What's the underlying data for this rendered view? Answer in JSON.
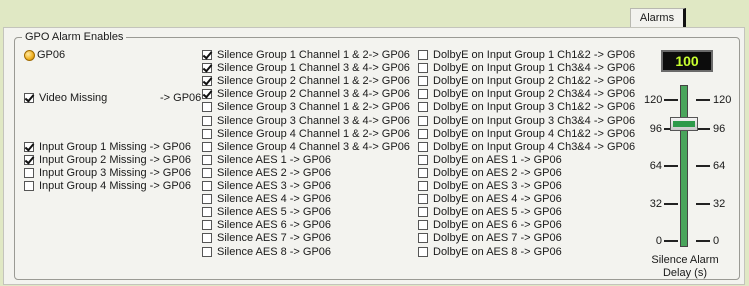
{
  "tabs": {
    "alarms_label": "Alarms"
  },
  "group": {
    "legend": "GPO Alarm Enables"
  },
  "gpo_indicator": {
    "label": "GP06"
  },
  "video_missing": {
    "label": "Video Missing",
    "target": "-> GP06",
    "checked": true
  },
  "input_missing": [
    {
      "label": "Input Group 1 Missing -> GP06",
      "checked": true
    },
    {
      "label": "Input Group 2 Missing -> GP06",
      "checked": true
    },
    {
      "label": "Input Group 3 Missing -> GP06",
      "checked": false
    },
    {
      "label": "Input Group 4 Missing -> GP06",
      "checked": false
    }
  ],
  "silence_groups": [
    {
      "label": "Silence Group 1 Channel 1 & 2-> GP06",
      "checked": true
    },
    {
      "label": "Silence Group 1 Channel 3 & 4-> GP06",
      "checked": true
    },
    {
      "label": "Silence Group 2 Channel 1 & 2-> GP06",
      "checked": true
    },
    {
      "label": "Silence Group 2 Channel 3 & 4-> GP06",
      "checked": true
    },
    {
      "label": "Silence Group 3 Channel 1 & 2-> GP06",
      "checked": false
    },
    {
      "label": "Silence Group 3 Channel 3 & 4-> GP06",
      "checked": false
    },
    {
      "label": "Silence Group 4 Channel 1 & 2-> GP06",
      "checked": false
    },
    {
      "label": "Silence Group 4 Channel 3 & 4-> GP06",
      "checked": false
    }
  ],
  "silence_aes": [
    {
      "label": "Silence AES 1 -> GP06",
      "checked": false
    },
    {
      "label": "Silence AES 2 -> GP06",
      "checked": false
    },
    {
      "label": "Silence AES 3 -> GP06",
      "checked": false
    },
    {
      "label": "Silence AES 4 -> GP06",
      "checked": false
    },
    {
      "label": "Silence AES 5 -> GP06",
      "checked": false
    },
    {
      "label": "Silence AES 6 -> GP06",
      "checked": false
    },
    {
      "label": "Silence AES 7 -> GP06",
      "checked": false
    },
    {
      "label": "Silence AES 8 -> GP06",
      "checked": false
    }
  ],
  "dolbye_groups": [
    {
      "label": "DolbyE on Input Group 1 Ch1&2 -> GP06",
      "checked": false
    },
    {
      "label": "DolbyE on Input Group 1 Ch3&4 -> GP06",
      "checked": false
    },
    {
      "label": "DolbyE on Input Group 2 Ch1&2 -> GP06",
      "checked": false
    },
    {
      "label": "DolbyE on Input Group 2 Ch3&4 -> GP06",
      "checked": false
    },
    {
      "label": "DolbyE on Input Group 3 Ch1&2 -> GP06",
      "checked": false
    },
    {
      "label": "DolbyE on Input Group 3 Ch3&4 -> GP06",
      "checked": false
    },
    {
      "label": "DolbyE on Input Group 4 Ch1&2 -> GP06",
      "checked": false
    },
    {
      "label": "DolbyE on Input Group 4 Ch3&4 -> GP06",
      "checked": false
    }
  ],
  "dolbye_aes": [
    {
      "label": "DolbyE on AES 1 -> GP06",
      "checked": false
    },
    {
      "label": "DolbyE on AES 2 -> GP06",
      "checked": false
    },
    {
      "label": "DolbyE on AES 3 -> GP06",
      "checked": false
    },
    {
      "label": "DolbyE on AES 4 -> GP06",
      "checked": false
    },
    {
      "label": "DolbyE on AES 5 -> GP06",
      "checked": false
    },
    {
      "label": "DolbyE on AES 6 -> GP06",
      "checked": false
    },
    {
      "label": "DolbyE on AES 7 -> GP06",
      "checked": false
    },
    {
      "label": "DolbyE on AES 8 -> GP06",
      "checked": false
    }
  ],
  "delay_slider": {
    "value": "100",
    "value_number": 100,
    "max": 128,
    "ticks": [
      "120",
      "96",
      "64",
      "32",
      "0"
    ],
    "caption_line1": "Silence Alarm",
    "caption_line2": "Delay (s)",
    "track_color": "#4aa55c",
    "value_color": "#c8ff30"
  }
}
